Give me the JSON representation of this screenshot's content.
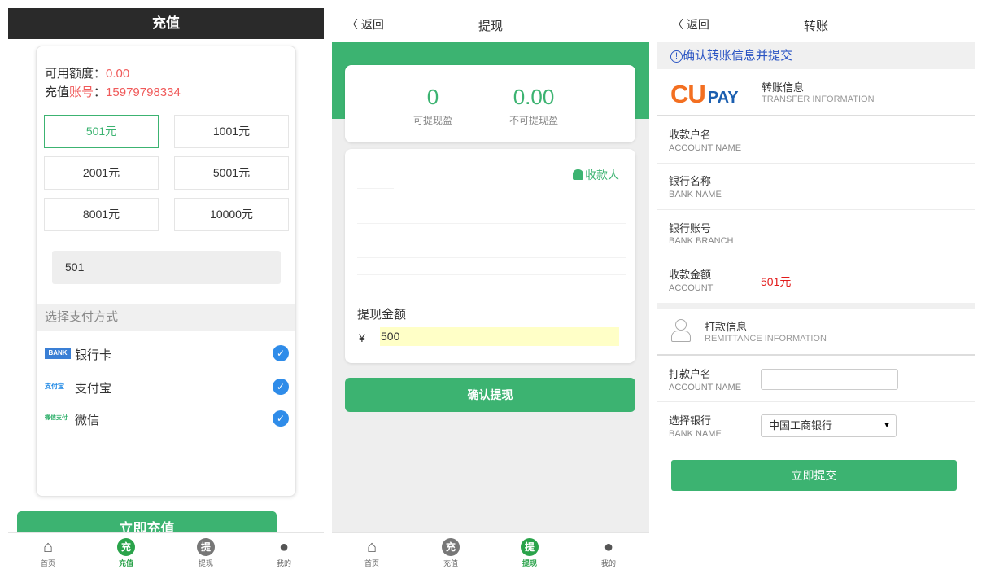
{
  "recharge": {
    "header_title": "充值",
    "available_label": "可用额度：",
    "available_value": "0.00",
    "account_label_prefix": "充值",
    "account_label_red": "账号",
    "account_label_colon": "：",
    "account_value": "15979798334",
    "amount_options": [
      "501元",
      "1001元",
      "2001元",
      "5001元",
      "8001元",
      "10000元"
    ],
    "selected_option": "501元",
    "amount_input_value": "501",
    "pay_method_label": "选择支付方式",
    "pay_methods": [
      {
        "name": "银行卡",
        "logo_text": "BANK",
        "icon": "bank-card-icon"
      },
      {
        "name": "支付宝",
        "logo_text": "支付宝",
        "icon": "alipay-icon"
      },
      {
        "name": "微信",
        "logo_text": "微信支付",
        "icon": "wechat-pay-icon"
      }
    ],
    "submit_label": "立即充值"
  },
  "tabbar": {
    "items": [
      {
        "label": "首页",
        "glyph": "⌂",
        "icon": "home-icon"
      },
      {
        "label": "充值",
        "glyph": "充",
        "icon": "recharge-icon"
      },
      {
        "label": "提现",
        "glyph": "提",
        "icon": "withdraw-icon"
      },
      {
        "label": "我的",
        "glyph": "●",
        "icon": "user-icon"
      }
    ]
  },
  "withdraw": {
    "back_label": "返回",
    "title": "提现",
    "withdrawable_value": "0",
    "withdrawable_label": "可提现盈",
    "non_withdrawable_value": "0.00",
    "non_withdrawable_label": "不可提现盈",
    "payee_label": "收款人",
    "amount_label": "提现金额",
    "currency": "¥",
    "amount_value": "500",
    "submit_label": "确认提现"
  },
  "transfer": {
    "back_label": "返回",
    "title": "转账",
    "notice": "确认转账信息并提交",
    "logo_cu": "CU",
    "logo_pay": "PAY",
    "transfer_info_title": "转账信息",
    "transfer_info_sub": "TRANSFER INFORMATION",
    "fields": [
      {
        "cn": "收款户名",
        "en": "ACCOUNT NAME",
        "value": ""
      },
      {
        "cn": "银行名称",
        "en": "BANK NAME",
        "value": ""
      },
      {
        "cn": "银行账号",
        "en": "BANK BRANCH",
        "value": ""
      },
      {
        "cn": "收款金额",
        "en": "ACCOUNT",
        "value": "501元"
      }
    ],
    "remit_info_title": "打款信息",
    "remit_info_sub": "REMITTANCE INFORMATION",
    "payer_name_cn": "打款户名",
    "payer_name_en": "ACCOUNT NAME",
    "payer_name_value": "",
    "bank_select_cn": "选择银行",
    "bank_select_en": "BANK NAME",
    "bank_select_value": "中国工商银行",
    "submit_label": "立即提交"
  },
  "colors": {
    "accent": "#3cb371",
    "red": "#f05a5a",
    "notice_blue": "#2a54c3",
    "check_blue": "#2f8ce9"
  }
}
